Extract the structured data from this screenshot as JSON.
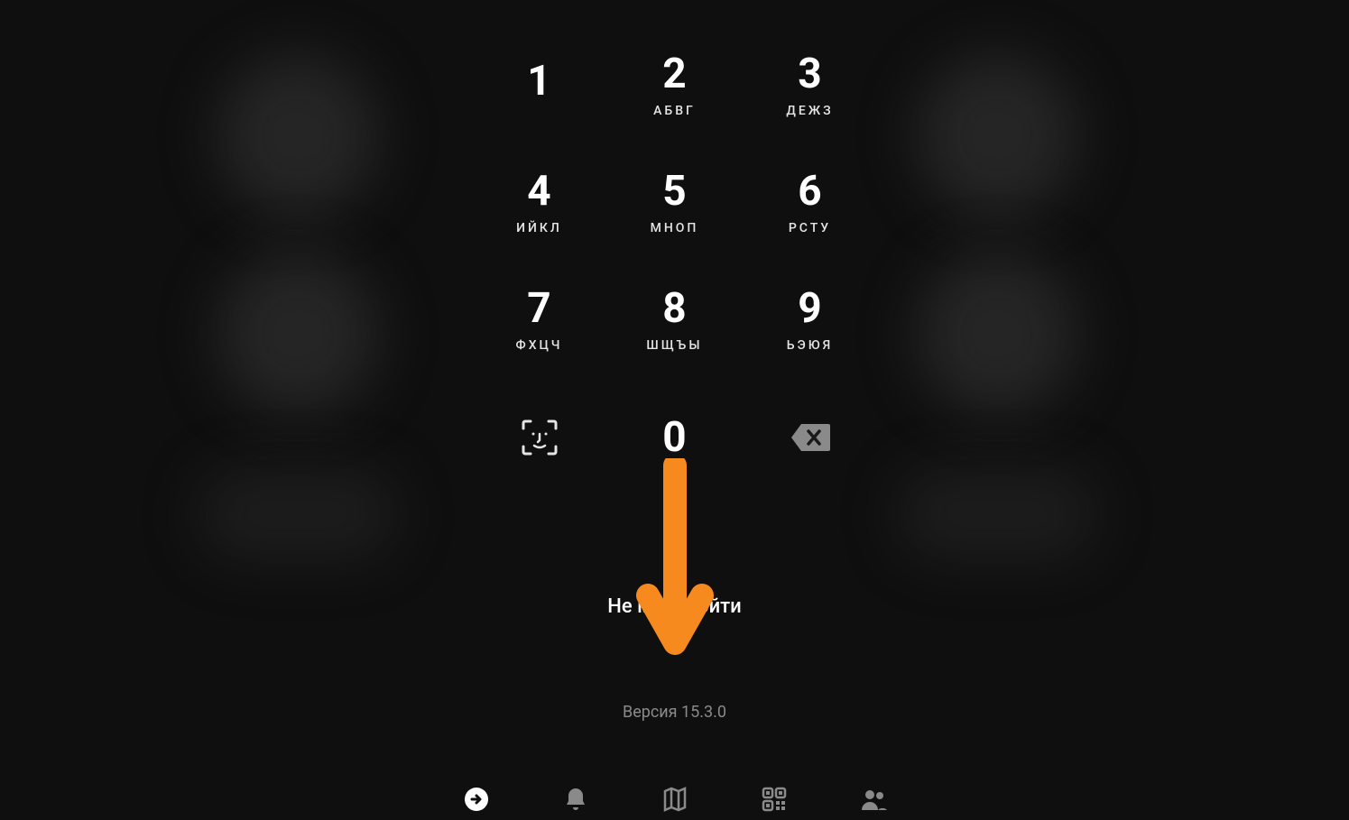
{
  "keypad": {
    "keys": [
      {
        "digit": "1",
        "letters": ""
      },
      {
        "digit": "2",
        "letters": "АБВГ"
      },
      {
        "digit": "3",
        "letters": "ДЕЖЗ"
      },
      {
        "digit": "4",
        "letters": "ИЙКЛ"
      },
      {
        "digit": "5",
        "letters": "МНОП"
      },
      {
        "digit": "6",
        "letters": "РСТУ"
      },
      {
        "digit": "7",
        "letters": "ФХЦЧ"
      },
      {
        "digit": "8",
        "letters": "ШЩЪЫ"
      },
      {
        "digit": "9",
        "letters": "ЬЭЮЯ"
      },
      {
        "digit": "0",
        "letters": ""
      }
    ]
  },
  "cant_login_label": "Не могу войти",
  "version_label": "Версия 15.3.0",
  "icons": {
    "faceid": "face-id-icon",
    "backspace": "backspace-icon"
  },
  "annotation": {
    "type": "arrow-down",
    "color": "#f68a1e"
  },
  "nav": {
    "items": [
      {
        "name": "main",
        "icon": "arrow-right-circle"
      },
      {
        "name": "notifications",
        "icon": "bell"
      },
      {
        "name": "map",
        "icon": "map"
      },
      {
        "name": "qr",
        "icon": "qr-code"
      },
      {
        "name": "contacts",
        "icon": "people"
      }
    ]
  }
}
